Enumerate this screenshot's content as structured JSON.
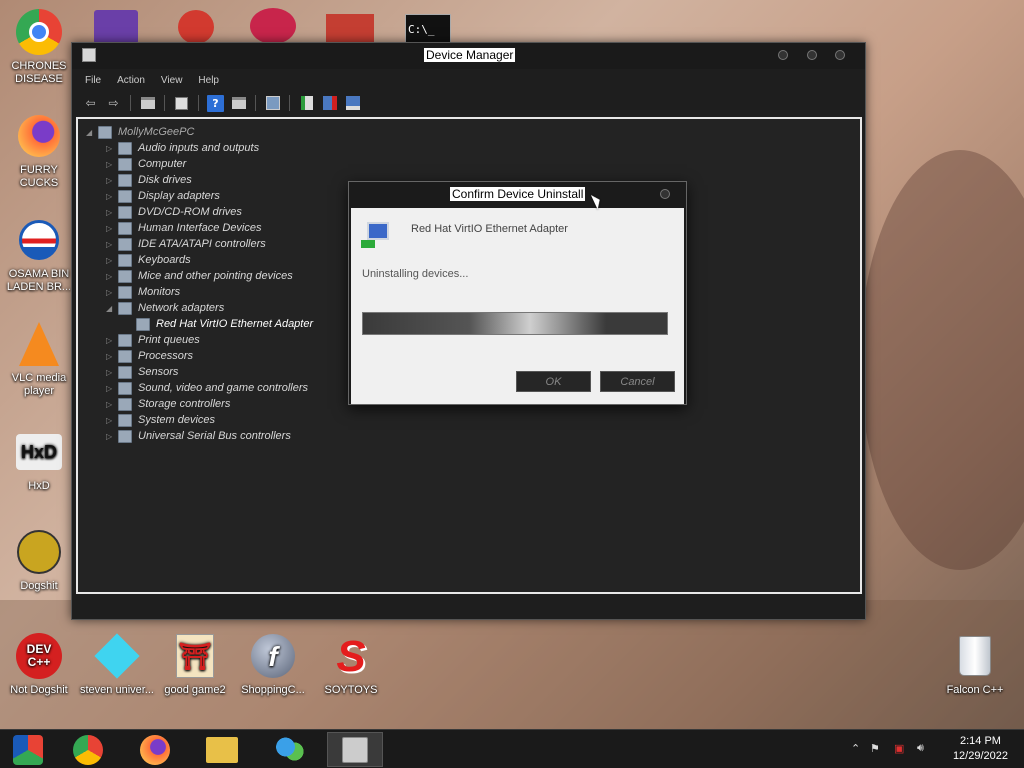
{
  "desktop": {
    "left_icons": [
      {
        "label": "CHRONES DISEASE",
        "icon": "chrome-icon"
      },
      {
        "label": "FURRY CUCKS",
        "icon": "firefox-icon"
      },
      {
        "label": "OSAMA BIN LADEN BR...",
        "icon": "obama-logo-icon"
      },
      {
        "label": "VLC media player",
        "icon": "vlc-icon"
      },
      {
        "label": "HxD",
        "icon": "hxd-icon"
      },
      {
        "label": "Dogshit",
        "icon": "dogshit-icon"
      }
    ],
    "bottom_icons": [
      {
        "label": "Not Dogshit",
        "icon": "devcpp-icon",
        "glyph": "DEV C++"
      },
      {
        "label": "steven univer...",
        "icon": "diamond-icon"
      },
      {
        "label": "good game2",
        "icon": "torii-icon"
      },
      {
        "label": "ShoppingC...",
        "icon": "flash-icon",
        "glyph": "f"
      },
      {
        "label": "SOYTOYS",
        "icon": "soytoys-icon",
        "glyph": "S"
      }
    ],
    "recycle_bin": {
      "label": "Falcon C++",
      "icon": "recycle-bin-icon"
    },
    "top_partial_icons": [
      "visual-studio-icon",
      "app-icon-2",
      "app-icon-3",
      "app-icon-4",
      "cmd-icon"
    ],
    "cmd_glyph": "C:\\_"
  },
  "device_manager": {
    "title": "Device Manager",
    "menu": [
      "File",
      "Action",
      "View",
      "Help"
    ],
    "toolbar_icons": [
      "back-icon",
      "forward-icon",
      "properties-icon",
      "list-icon",
      "help-icon",
      "view-icon",
      "scan-icon",
      "update-driver-icon",
      "uninstall-icon",
      "add-hardware-icon"
    ],
    "toolbar_glyphs": {
      "back": "⇦",
      "forward": "⇨",
      "help": "?"
    },
    "tree": {
      "root": "MollyMcGeePC",
      "categories": [
        {
          "label": "Audio inputs and outputs",
          "icon": "audio-icon"
        },
        {
          "label": "Computer",
          "icon": "computer-icon"
        },
        {
          "label": "Disk drives",
          "icon": "disk-icon"
        },
        {
          "label": "Display adapters",
          "icon": "display-icon"
        },
        {
          "label": "DVD/CD-ROM drives",
          "icon": "dvd-icon"
        },
        {
          "label": "Human Interface Devices",
          "icon": "hid-icon"
        },
        {
          "label": "IDE ATA/ATAPI controllers",
          "icon": "ide-icon"
        },
        {
          "label": "Keyboards",
          "icon": "keyboard-icon"
        },
        {
          "label": "Mice and other pointing devices",
          "icon": "mouse-icon"
        },
        {
          "label": "Monitors",
          "icon": "monitor-icon"
        },
        {
          "label": "Network adapters",
          "icon": "network-icon"
        },
        {
          "label": "Red Hat VirtIO Ethernet Adapter",
          "icon": "network-adapter-icon",
          "child": true
        },
        {
          "label": "Print queues",
          "icon": "printer-icon"
        },
        {
          "label": "Processors",
          "icon": "processor-icon"
        },
        {
          "label": "Sensors",
          "icon": "sensor-icon"
        },
        {
          "label": "Sound, video and game controllers",
          "icon": "sound-icon"
        },
        {
          "label": "Storage controllers",
          "icon": "storage-icon"
        },
        {
          "label": "System devices",
          "icon": "system-icon"
        },
        {
          "label": "Universal Serial Bus controllers",
          "icon": "usb-icon"
        }
      ]
    }
  },
  "dialog": {
    "title": "Confirm Device Uninstall",
    "device_name": "Red Hat VirtIO Ethernet Adapter",
    "status": "Uninstalling devices...",
    "ok_label": "OK",
    "cancel_label": "Cancel"
  },
  "taskbar": {
    "apps": [
      "chrome-alt-icon",
      "chrome-icon",
      "firefox-icon",
      "file-explorer-icon",
      "people-icon",
      "device-manager-icon"
    ],
    "clock": {
      "time": "2:14 PM",
      "date": "12/29/2022"
    }
  }
}
